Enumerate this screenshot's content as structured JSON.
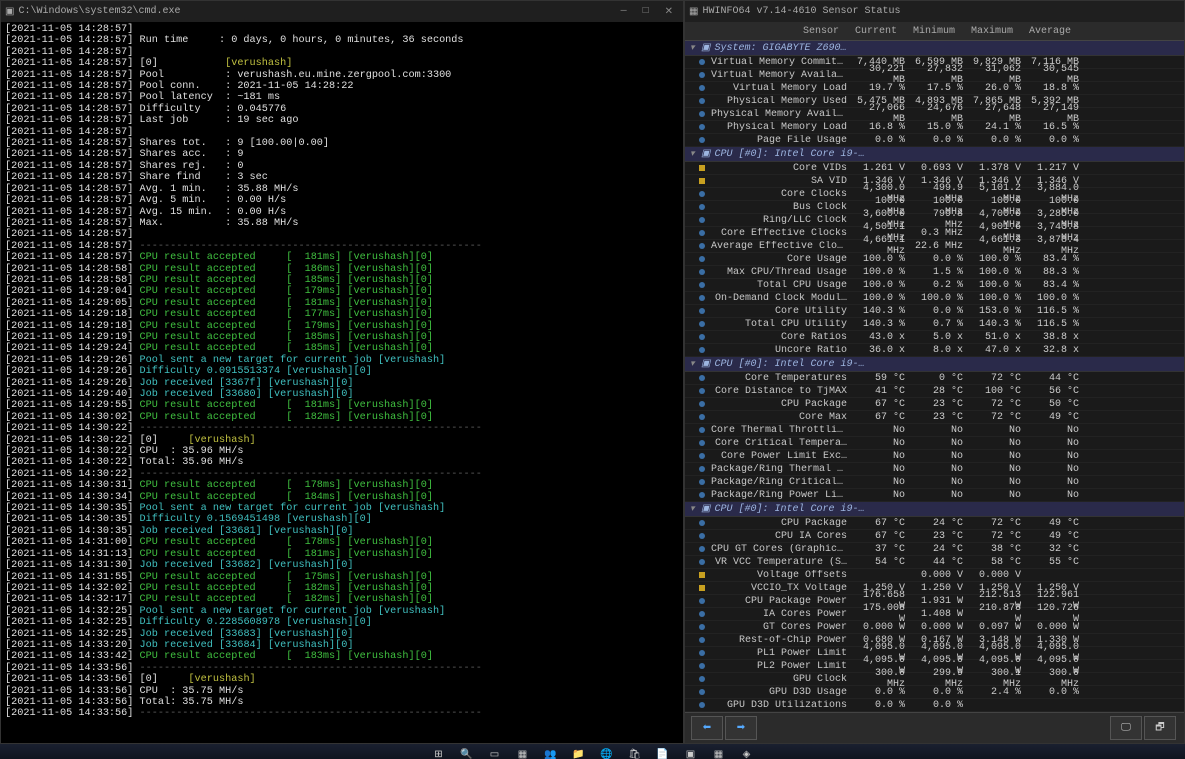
{
  "cmd": {
    "title": "C:\\Windows\\system32\\cmd.exe",
    "win_min": "—",
    "win_max": "□",
    "win_close": "✕",
    "lines": [
      {
        "t": "[2021-11-05 14:28:57]",
        "b": ""
      },
      {
        "t": "[2021-11-05 14:28:57]",
        "b": " Run time     : 0 days, 0 hours, 0 minutes, 36 seconds"
      },
      {
        "t": "[2021-11-05 14:28:57]",
        "b": ""
      },
      {
        "t": "[2021-11-05 14:28:57]",
        "b": " [0]           ",
        "e": "[verushash]",
        "cls": "c-y"
      },
      {
        "t": "[2021-11-05 14:28:57]",
        "b": " Pool          : verushash.eu.mine.zergpool.com:3300"
      },
      {
        "t": "[2021-11-05 14:28:57]",
        "b": " Pool conn.    : 2021-11-05 14:28:22"
      },
      {
        "t": "[2021-11-05 14:28:57]",
        "b": " Pool latency  : ~181 ms"
      },
      {
        "t": "[2021-11-05 14:28:57]",
        "b": " Difficulty    : 0.045776"
      },
      {
        "t": "[2021-11-05 14:28:57]",
        "b": " Last job      : 19 sec ago"
      },
      {
        "t": "[2021-11-05 14:28:57]",
        "b": ""
      },
      {
        "t": "[2021-11-05 14:28:57]",
        "b": " Shares tot.   : 9 [100.00|0.00]"
      },
      {
        "t": "[2021-11-05 14:28:57]",
        "b": " Shares acc.   : 9"
      },
      {
        "t": "[2021-11-05 14:28:57]",
        "b": " Shares rej.   : 0"
      },
      {
        "t": "[2021-11-05 14:28:57]",
        "b": " Share find    : 3 sec"
      },
      {
        "t": "[2021-11-05 14:28:57]",
        "b": " Avg. 1 min.   : 35.88 MH/s"
      },
      {
        "t": "[2021-11-05 14:28:57]",
        "b": " Avg. 5 min.   : 0.00 H/s"
      },
      {
        "t": "[2021-11-05 14:28:57]",
        "b": " Avg. 15 min.  : 0.00 H/s"
      },
      {
        "t": "[2021-11-05 14:28:57]",
        "b": " Max.          : 35.88 MH/s"
      },
      {
        "t": "[2021-11-05 14:28:57]",
        "b": ""
      },
      {
        "t": "[2021-11-05 14:28:57]",
        "b": " ",
        "e": "--------------------------------------------------------",
        "cls": "c-dash"
      },
      {
        "t": "[2021-11-05 14:28:57]",
        "b": " ",
        "g": "CPU result accepted     [  181ms] [verushash][0]"
      },
      {
        "t": "[2021-11-05 14:28:58]",
        "b": " ",
        "g": "CPU result accepted     [  186ms] [verushash][0]"
      },
      {
        "t": "[2021-11-05 14:28:58]",
        "b": " ",
        "g": "CPU result accepted     [  185ms] [verushash][0]"
      },
      {
        "t": "[2021-11-05 14:29:04]",
        "b": " ",
        "g": "CPU result accepted     [  179ms] [verushash][0]"
      },
      {
        "t": "[2021-11-05 14:29:05]",
        "b": " ",
        "g": "CPU result accepted     [  181ms] [verushash][0]"
      },
      {
        "t": "[2021-11-05 14:29:18]",
        "b": " ",
        "g": "CPU result accepted     [  177ms] [verushash][0]"
      },
      {
        "t": "[2021-11-05 14:29:18]",
        "b": " ",
        "g": "CPU result accepted     [  179ms] [verushash][0]"
      },
      {
        "t": "[2021-11-05 14:29:19]",
        "b": " ",
        "g": "CPU result accepted     [  185ms] [verushash][0]"
      },
      {
        "t": "[2021-11-05 14:29:24]",
        "b": " ",
        "g": "CPU result accepted     [  185ms] [verushash][0]"
      },
      {
        "t": "[2021-11-05 14:29:26]",
        "b": " ",
        "c": "Pool sent a new target for current job [verushash]"
      },
      {
        "t": "[2021-11-05 14:29:26]",
        "b": " ",
        "c": "Difficulty 0.0915513374 [verushash][0]"
      },
      {
        "t": "[2021-11-05 14:29:26]",
        "b": " ",
        "c": "Job received [3367f] [verushash][0]"
      },
      {
        "t": "[2021-11-05 14:29:40]",
        "b": " ",
        "c": "Job received [33680] [verushash][0]"
      },
      {
        "t": "[2021-11-05 14:29:55]",
        "b": " ",
        "g": "CPU result accepted     [  181ms] [verushash][0]"
      },
      {
        "t": "[2021-11-05 14:30:02]",
        "b": " ",
        "g": "CPU result accepted     [  182ms] [verushash][0]"
      },
      {
        "t": "[2021-11-05 14:30:22]",
        "b": " ",
        "e": "--------------------------------------------------------",
        "cls": "c-dash"
      },
      {
        "t": "[2021-11-05 14:30:22]",
        "b": " [0]     ",
        "e": "[verushash]",
        "cls": "c-y"
      },
      {
        "t": "[2021-11-05 14:30:22]",
        "b": " CPU  : 35.96 MH/s"
      },
      {
        "t": "[2021-11-05 14:30:22]",
        "b": " Total: 35.96 MH/s"
      },
      {
        "t": "[2021-11-05 14:30:22]",
        "b": " ",
        "e": "--------------------------------------------------------",
        "cls": "c-dash"
      },
      {
        "t": "[2021-11-05 14:30:31]",
        "b": " ",
        "g": "CPU result accepted     [  178ms] [verushash][0]"
      },
      {
        "t": "[2021-11-05 14:30:34]",
        "b": " ",
        "g": "CPU result accepted     [  184ms] [verushash][0]"
      },
      {
        "t": "[2021-11-05 14:30:35]",
        "b": " ",
        "c": "Pool sent a new target for current job [verushash]"
      },
      {
        "t": "[2021-11-05 14:30:35]",
        "b": " ",
        "c": "Difficulty 0.1569451498 [verushash][0]"
      },
      {
        "t": "[2021-11-05 14:30:35]",
        "b": " ",
        "c": "Job received [33681] [verushash][0]"
      },
      {
        "t": "[2021-11-05 14:31:00]",
        "b": " ",
        "g": "CPU result accepted     [  178ms] [verushash][0]"
      },
      {
        "t": "[2021-11-05 14:31:13]",
        "b": " ",
        "g": "CPU result accepted     [  181ms] [verushash][0]"
      },
      {
        "t": "[2021-11-05 14:31:30]",
        "b": " ",
        "c": "Job received [33682] [verushash][0]"
      },
      {
        "t": "[2021-11-05 14:31:55]",
        "b": " ",
        "g": "CPU result accepted     [  175ms] [verushash][0]"
      },
      {
        "t": "[2021-11-05 14:32:02]",
        "b": " ",
        "g": "CPU result accepted     [  182ms] [verushash][0]"
      },
      {
        "t": "[2021-11-05 14:32:17]",
        "b": " ",
        "g": "CPU result accepted     [  182ms] [verushash][0]"
      },
      {
        "t": "[2021-11-05 14:32:25]",
        "b": " ",
        "c": "Pool sent a new target for current job [verushash]"
      },
      {
        "t": "[2021-11-05 14:32:25]",
        "b": " ",
        "c": "Difficulty 0.2285608978 [verushash][0]"
      },
      {
        "t": "[2021-11-05 14:32:25]",
        "b": " ",
        "c": "Job received [33683] [verushash][0]"
      },
      {
        "t": "[2021-11-05 14:33:20]",
        "b": " ",
        "c": "Job received [33684] [verushash][0]"
      },
      {
        "t": "[2021-11-05 14:33:42]",
        "b": " ",
        "g": "CPU result accepted     [  183ms] [verushash][0]"
      },
      {
        "t": "[2021-11-05 14:33:56]",
        "b": " ",
        "e": "--------------------------------------------------------",
        "cls": "c-dash"
      },
      {
        "t": "[2021-11-05 14:33:56]",
        "b": " [0]     ",
        "e": "[verushash]",
        "cls": "c-y"
      },
      {
        "t": "[2021-11-05 14:33:56]",
        "b": " CPU  : 35.75 MH/s"
      },
      {
        "t": "[2021-11-05 14:33:56]",
        "b": " Total: 35.75 MH/s"
      },
      {
        "t": "[2021-11-05 14:33:56]",
        "b": " ",
        "e": "--------------------------------------------------------",
        "cls": "c-dash"
      }
    ]
  },
  "hw": {
    "title": "HWINFO64 v7.14-4610 Sensor Status",
    "headers": {
      "sensor": "Sensor",
      "current": "Current",
      "minimum": "Minimum",
      "maximum": "Maximum",
      "average": "Average"
    },
    "sections": [
      {
        "title": "System: GIGABYTE Z690…",
        "rows": [
          {
            "n": "Virtual Memory Committed",
            "i": "b",
            "c": "7,440 MB",
            "mn": "6,599 MB",
            "mx": "9,829 MB",
            "av": "7,116 MB"
          },
          {
            "n": "Virtual Memory Available",
            "i": "b",
            "c": "30,221 MB",
            "mn": "27,832 MB",
            "mx": "31,062 MB",
            "av": "30,545 MB"
          },
          {
            "n": "Virtual Memory Load",
            "i": "b",
            "c": "19.7 %",
            "mn": "17.5 %",
            "mx": "26.0 %",
            "av": "18.8 %"
          },
          {
            "n": "Physical Memory Used",
            "i": "b",
            "c": "5,475 MB",
            "mn": "4,893 MB",
            "mx": "7,865 MB",
            "av": "5,392 MB"
          },
          {
            "n": "Physical Memory Available",
            "i": "b",
            "c": "27,066 MB",
            "mn": "24,676 MB",
            "mx": "27,648 MB",
            "av": "27,149 MB"
          },
          {
            "n": "Physical Memory Load",
            "i": "b",
            "c": "16.8 %",
            "mn": "15.0 %",
            "mx": "24.1 %",
            "av": "16.5 %"
          },
          {
            "n": "Page File Usage",
            "i": "b",
            "c": "0.0 %",
            "mn": "0.0 %",
            "mx": "0.0 %",
            "av": "0.0 %"
          }
        ]
      },
      {
        "title": "CPU [#0]: Intel Core i9-…",
        "rows": [
          {
            "n": "Core VIDs",
            "i": "y",
            "c": "1.261 V",
            "mn": "0.693 V",
            "mx": "1.378 V",
            "av": "1.217 V"
          },
          {
            "n": "SA VID",
            "i": "y",
            "c": "1.346 V",
            "mn": "1.346 V",
            "mx": "1.346 V",
            "av": "1.346 V"
          },
          {
            "n": "Core Clocks",
            "i": "b",
            "c": "4,300.0 MHz",
            "mn": "499.9 MHz",
            "mx": "5,101.2 MHz",
            "av": "3,884.0 MHz"
          },
          {
            "n": "Bus Clock",
            "i": "b",
            "c": "100.0 MHz",
            "mn": "100.0 MHz",
            "mx": "100.0 MHz",
            "av": "100.0 MHz"
          },
          {
            "n": "Ring/LLC Clock",
            "i": "b",
            "c": "3,600.0 MHz",
            "mn": "799.8 MHz",
            "mx": "4,700.0 MHz",
            "av": "3,285.0 MHz"
          },
          {
            "n": "Core Effective Clocks",
            "i": "b",
            "c": "4,501.1 MHz",
            "mn": "0.3 MHz",
            "mx": "4,901.6 MHz",
            "av": "3,743.8 MHz"
          },
          {
            "n": "Average Effective Clock",
            "i": "b",
            "c": "4,661.1 MHz",
            "mn": "22.6 MHz",
            "mx": "4,661.3 MHz",
            "av": "3,878.4 MHz"
          },
          {
            "n": "Core Usage",
            "i": "b",
            "c": "100.0 %",
            "mn": "0.0 %",
            "mx": "100.0 %",
            "av": "83.4 %"
          },
          {
            "n": "Max CPU/Thread Usage",
            "i": "b",
            "c": "100.0 %",
            "mn": "1.5 %",
            "mx": "100.0 %",
            "av": "88.3 %"
          },
          {
            "n": "Total CPU Usage",
            "i": "b",
            "c": "100.0 %",
            "mn": "0.2 %",
            "mx": "100.0 %",
            "av": "83.4 %"
          },
          {
            "n": "On-Demand Clock Modul…",
            "i": "b",
            "c": "100.0 %",
            "mn": "100.0 %",
            "mx": "100.0 %",
            "av": "100.0 %"
          },
          {
            "n": "Core Utility",
            "i": "b",
            "c": "140.3 %",
            "mn": "0.0 %",
            "mx": "153.0 %",
            "av": "116.5 %"
          },
          {
            "n": "Total CPU Utility",
            "i": "b",
            "c": "140.3 %",
            "mn": "0.7 %",
            "mx": "140.3 %",
            "av": "116.5 %"
          },
          {
            "n": "Core Ratios",
            "i": "b",
            "c": "43.0 x",
            "mn": "5.0 x",
            "mx": "51.0 x",
            "av": "38.8 x"
          },
          {
            "n": "Uncore Ratio",
            "i": "b",
            "c": "36.0 x",
            "mn": "8.0 x",
            "mx": "47.0 x",
            "av": "32.8 x"
          }
        ]
      },
      {
        "title": "CPU [#0]: Intel Core i9-…",
        "rows": [
          {
            "n": "Core Temperatures",
            "i": "b",
            "c": "59 °C",
            "mn": "0 °C",
            "mx": "72 °C",
            "av": "44 °C"
          },
          {
            "n": "Core Distance to TjMAX",
            "i": "b",
            "c": "41 °C",
            "mn": "28 °C",
            "mx": "100 °C",
            "av": "56 °C"
          },
          {
            "n": "CPU Package",
            "i": "b",
            "c": "67 °C",
            "mn": "23 °C",
            "mx": "72 °C",
            "av": "50 °C"
          },
          {
            "n": "Core Max",
            "i": "b",
            "c": "67 °C",
            "mn": "23 °C",
            "mx": "72 °C",
            "av": "49 °C"
          },
          {
            "n": "Core Thermal Throttling",
            "i": "b",
            "c": "No",
            "mn": "No",
            "mx": "No",
            "av": "No"
          },
          {
            "n": "Core Critical Tempera…",
            "i": "b",
            "c": "No",
            "mn": "No",
            "mx": "No",
            "av": "No"
          },
          {
            "n": "Core Power Limit Exc…",
            "i": "b",
            "c": "No",
            "mn": "No",
            "mx": "No",
            "av": "No"
          },
          {
            "n": "Package/Ring Thermal T…",
            "i": "b",
            "c": "No",
            "mn": "No",
            "mx": "No",
            "av": "No"
          },
          {
            "n": "Package/Ring Critical Te…",
            "i": "b",
            "c": "No",
            "mn": "No",
            "mx": "No",
            "av": "No"
          },
          {
            "n": "Package/Ring Power Limi…",
            "i": "b",
            "c": "No",
            "mn": "No",
            "mx": "No",
            "av": "No"
          }
        ]
      },
      {
        "title": "CPU [#0]: Intel Core i9-…",
        "rows": [
          {
            "n": "CPU Package",
            "i": "b",
            "c": "67 °C",
            "mn": "24 °C",
            "mx": "72 °C",
            "av": "49 °C"
          },
          {
            "n": "CPU IA Cores",
            "i": "b",
            "c": "67 °C",
            "mn": "23 °C",
            "mx": "72 °C",
            "av": "49 °C"
          },
          {
            "n": "CPU GT Cores (Graphics)",
            "i": "b",
            "c": "37 °C",
            "mn": "24 °C",
            "mx": "38 °C",
            "av": "32 °C"
          },
          {
            "n": "VR VCC Temperature (S…",
            "i": "b",
            "c": "54 °C",
            "mn": "44 °C",
            "mx": "58 °C",
            "av": "55 °C"
          },
          {
            "n": "Voltage Offsets",
            "i": "y",
            "c": "",
            "mn": "0.000 V",
            "mx": "0.000 V",
            "av": ""
          },
          {
            "n": "VCCIO_TX Voltage",
            "i": "y",
            "c": "1.250 V",
            "mn": "1.250 V",
            "mx": "1.250 V",
            "av": "1.250 V"
          },
          {
            "n": "CPU Package Power",
            "i": "b",
            "c": "176.658 W",
            "mn": "1.931 W",
            "mx": "212.513 W",
            "av": "122.961 W"
          },
          {
            "n": "IA Cores Power",
            "i": "b",
            "c": "175.008 W",
            "mn": "1.408 W",
            "mx": "210.873 W",
            "av": "120.726 W"
          },
          {
            "n": "GT Cores Power",
            "i": "b",
            "c": "0.000 W",
            "mn": "0.000 W",
            "mx": "0.097 W",
            "av": "0.000 W"
          },
          {
            "n": "Rest-of-Chip Power",
            "i": "b",
            "c": "0.680 W",
            "mn": "0.167 W",
            "mx": "3.148 W",
            "av": "1.330 W"
          },
          {
            "n": "PL1 Power Limit",
            "i": "b",
            "c": "4,095.0 W",
            "mn": "4,095.0 W",
            "mx": "4,095.0 W",
            "av": "4,095.0 W"
          },
          {
            "n": "PL2 Power Limit",
            "i": "b",
            "c": "4,095.0 W",
            "mn": "4,095.0 W",
            "mx": "4,095.0 W",
            "av": "4,095.0 W"
          },
          {
            "n": "GPU Clock",
            "i": "b",
            "c": "300.0 MHz",
            "mn": "299.9 MHz",
            "mx": "300.1 MHz",
            "av": "300.0 MHz"
          },
          {
            "n": "GPU D3D Usage",
            "i": "b",
            "c": "0.0 %",
            "mn": "0.0 %",
            "mx": "2.4 %",
            "av": "0.0 %"
          },
          {
            "n": "GPU D3D Utilizations",
            "i": "b",
            "c": "0.0 %",
            "mn": "0.0 %",
            "mx": "",
            "av": ""
          }
        ]
      }
    ]
  },
  "taskbar": {
    "items": [
      "start",
      "search",
      "task-view",
      "widgets",
      "teams",
      "explorer",
      "edge",
      "store",
      "notepad",
      "terminal",
      "hwinfo",
      "app"
    ]
  }
}
